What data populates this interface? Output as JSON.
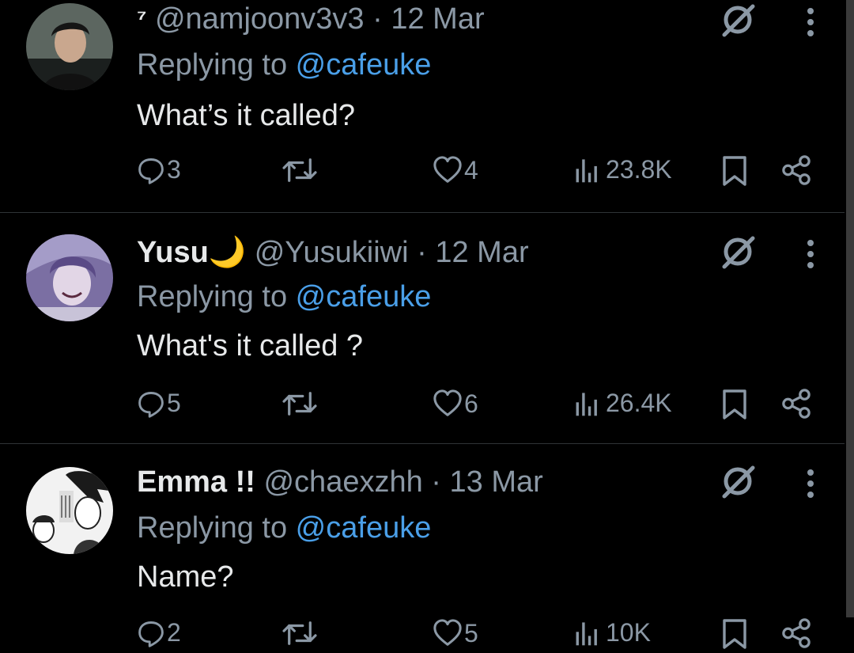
{
  "tweets": [
    {
      "name": "⁷",
      "handle": "@namjoonv3v3",
      "dot": "·",
      "time": "12 Mar",
      "replying_prefix": "Replying to ",
      "replying_to": "@cafeuke",
      "text": "What’s it called?",
      "replies": "3",
      "likes": "4",
      "views": "23.8K"
    },
    {
      "name": "Yusu🌙",
      "handle": "@Yusukiiwi",
      "dot": "·",
      "time": "12 Mar",
      "replying_prefix": "Replying to ",
      "replying_to": "@cafeuke",
      "text": "What's it called ?",
      "replies": "5",
      "likes": "6",
      "views": "26.4K"
    },
    {
      "name": "Emma !!",
      "handle": "@chaexzhh",
      "dot": "·",
      "time": "13 Mar",
      "replying_prefix": "Replying to ",
      "replying_to": "@cafeuke",
      "text": "Name?",
      "replies": "2",
      "likes": "5",
      "views": "10K"
    }
  ],
  "colors": {
    "background": "#000000",
    "muted": "#8b98a5",
    "accent": "#4a9fe8",
    "text": "#e7e9ea",
    "divider": "#2f3336"
  },
  "icons": [
    "grok-icon",
    "more-icon",
    "reply-icon",
    "retweet-icon",
    "like-icon",
    "views-icon",
    "bookmark-icon",
    "share-icon"
  ]
}
